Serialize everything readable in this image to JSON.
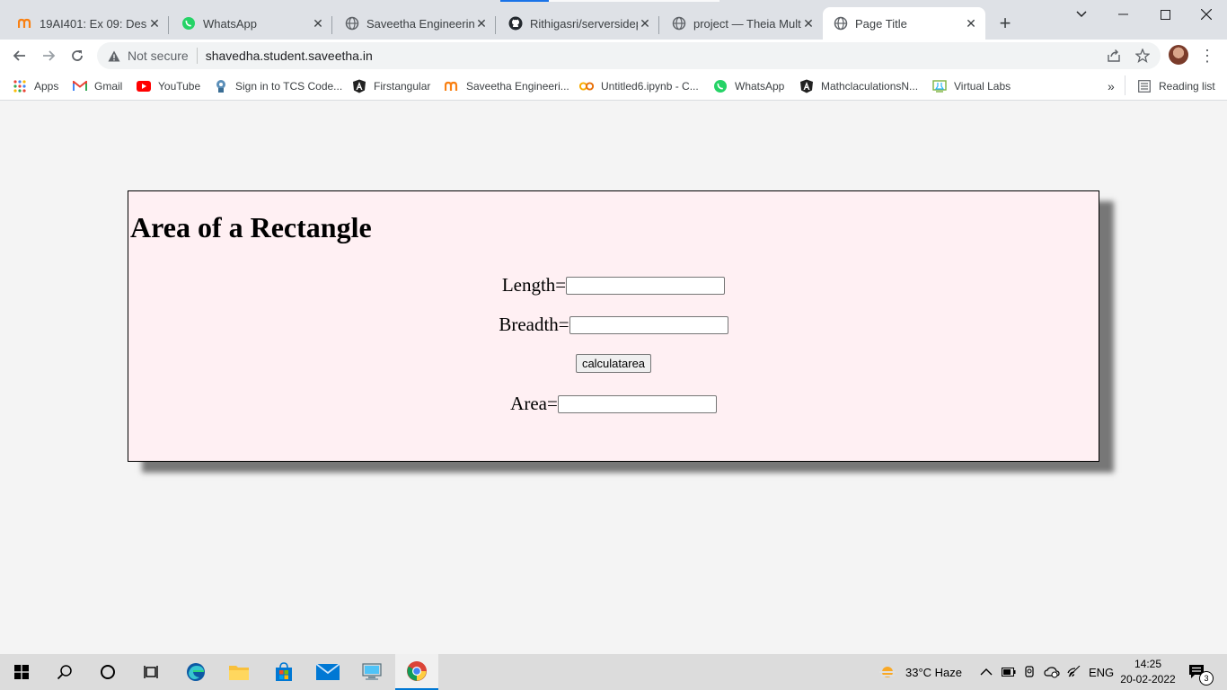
{
  "browser": {
    "tabs": [
      {
        "title": "19AI401: Ex 09: Design",
        "icon": "moodle-icon"
      },
      {
        "title": "WhatsApp",
        "icon": "whatsapp-icon"
      },
      {
        "title": "Saveetha Engineering",
        "icon": "globe-icon"
      },
      {
        "title": "Rithigasri/serversidepr",
        "icon": "github-icon"
      },
      {
        "title": "project — Theia Multi",
        "icon": "globe-icon"
      },
      {
        "title": "Page Title",
        "icon": "globe-icon",
        "active": true
      }
    ],
    "security_label": "Not secure",
    "url": "shavedha.student.saveetha.in",
    "bookmarks": [
      {
        "label": "Apps",
        "icon": "apps-grid-icon"
      },
      {
        "label": "Gmail",
        "icon": "gmail-icon"
      },
      {
        "label": "YouTube",
        "icon": "youtube-icon"
      },
      {
        "label": "Sign in to TCS Code...",
        "icon": "tcs-icon"
      },
      {
        "label": "Firstangular",
        "icon": "angular-icon"
      },
      {
        "label": "Saveetha Engineeri...",
        "icon": "moodle-icon"
      },
      {
        "label": "Untitled6.ipynb - C...",
        "icon": "colab-icon"
      },
      {
        "label": "WhatsApp",
        "icon": "whatsapp-icon"
      },
      {
        "label": "MathclaculationsN...",
        "icon": "angular-icon"
      },
      {
        "label": "Virtual Labs",
        "icon": "virtual-labs-icon"
      }
    ],
    "reading_list": "Reading list"
  },
  "page": {
    "heading": "Area of a Rectangle",
    "length_label": "Length=",
    "breadth_label": "Breadth=",
    "button_label": "calculatarea",
    "area_label": "Area=",
    "length_value": "",
    "breadth_value": "",
    "area_value": ""
  },
  "taskbar": {
    "weather": "33°C  Haze",
    "language": "ENG",
    "time": "14:25",
    "date": "20-02-2022",
    "notification_count": "3"
  },
  "colors": {
    "card_background": "#fff0f3",
    "page_background": "#f4f4f4",
    "tab_strip": "#dee1e6"
  }
}
